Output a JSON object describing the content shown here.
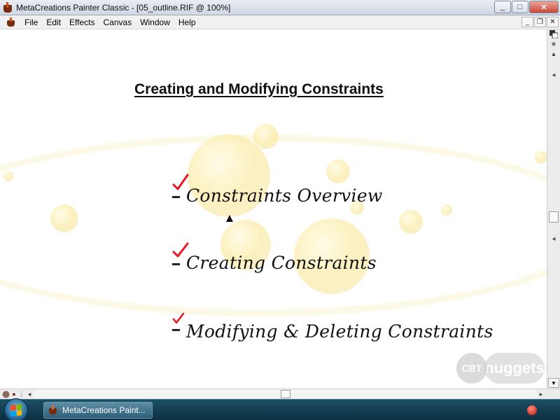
{
  "window": {
    "title": "MetaCreations Painter Classic - [05_outline.RIF @ 100%]",
    "controls": {
      "minimize": "_",
      "maximize": "□",
      "close": "✕"
    }
  },
  "menubar": {
    "items": [
      "File",
      "Edit",
      "Effects",
      "Canvas",
      "Window",
      "Help"
    ],
    "mdi_controls": {
      "minimize": "_",
      "restore": "❐",
      "close": "✕"
    }
  },
  "slide": {
    "title": "Creating and Modifying Constraints",
    "bullets": [
      {
        "text": "Constraints Overview",
        "checked": true
      },
      {
        "text": "Creating Constraints",
        "checked": true
      },
      {
        "text": "Modifying & Deleting Constraints",
        "checked": true
      }
    ]
  },
  "watermark": {
    "circle": "CBT",
    "text": "nuggets"
  },
  "taskbar": {
    "button_label": "MetaCreations Paint..."
  },
  "colors": {
    "check": "#e8141e",
    "taskbar": "#123e52",
    "title_bg": "#dfe6ef"
  },
  "icons": {
    "app": "painter-cup-icon",
    "start": "windows-start-icon",
    "tray": "tray-red-ball-icon"
  }
}
